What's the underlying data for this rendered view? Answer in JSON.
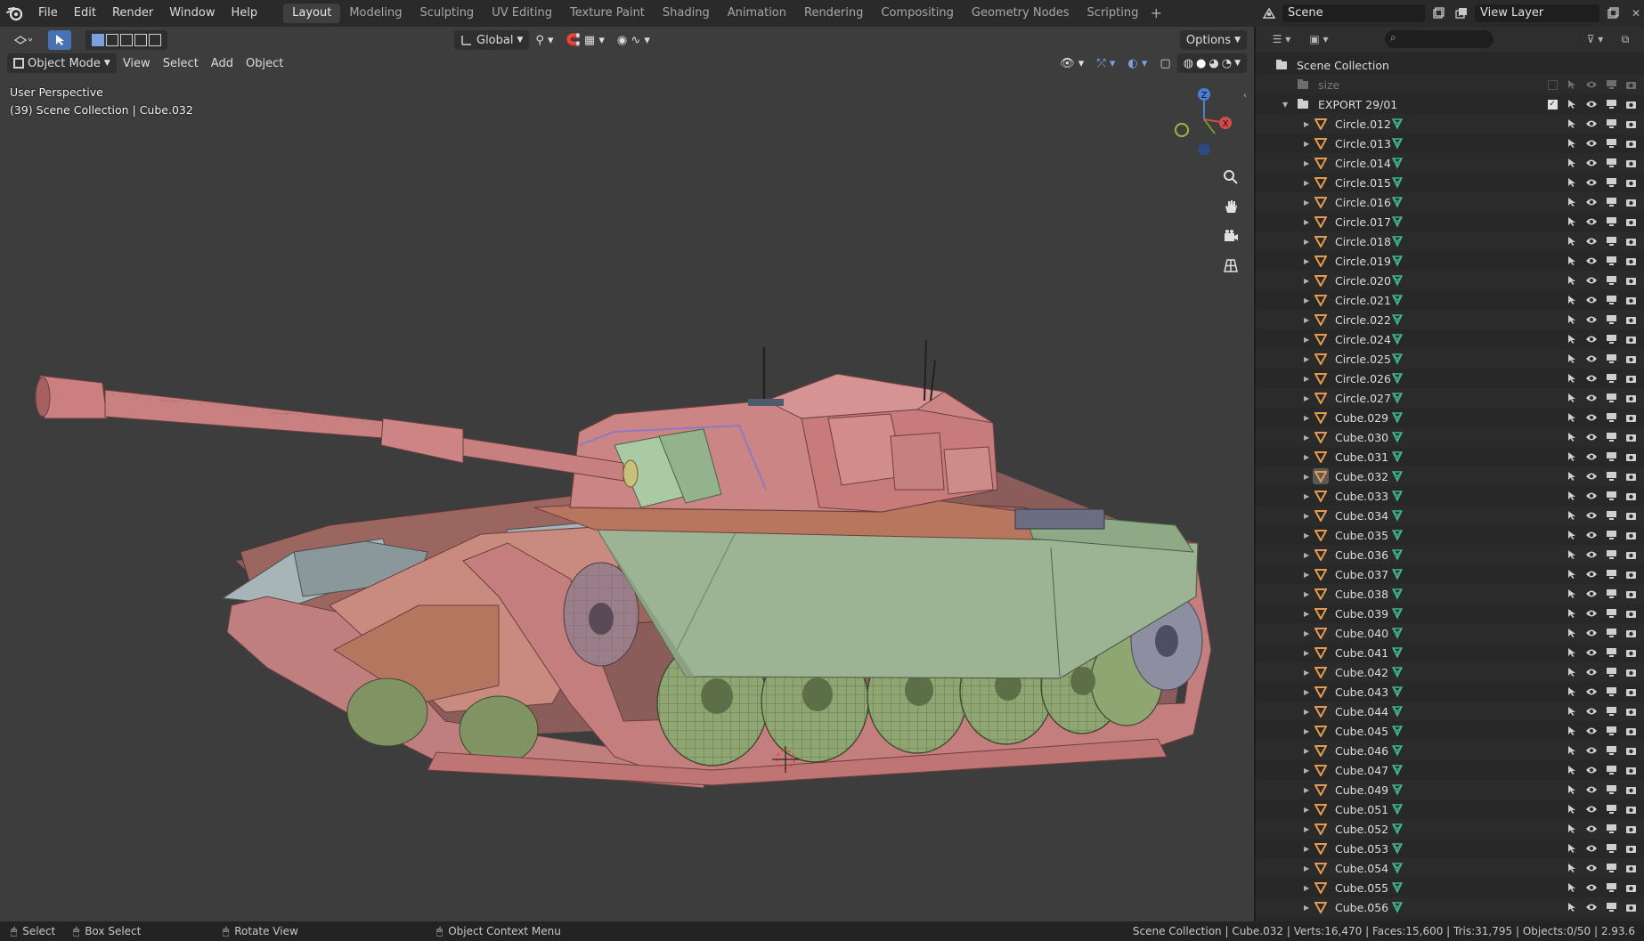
{
  "topbar": {
    "menus": [
      "File",
      "Edit",
      "Render",
      "Window",
      "Help"
    ],
    "workspaces": [
      "Layout",
      "Modeling",
      "Sculpting",
      "UV Editing",
      "Texture Paint",
      "Shading",
      "Animation",
      "Rendering",
      "Compositing",
      "Geometry Nodes",
      "Scripting"
    ],
    "active_workspace": "Layout",
    "scene": "Scene",
    "view_layer": "View Layer"
  },
  "viewport": {
    "transform_orientation": "Global",
    "options_label": "Options",
    "mode": "Object Mode",
    "menus": [
      "View",
      "Select",
      "Add",
      "Object"
    ],
    "perspective_label": "User Perspective",
    "collection_info": "(39) Scene Collection | Cube.032",
    "gizmo": {
      "z": "Z",
      "x": "X"
    }
  },
  "outliner": {
    "root": "Scene Collection",
    "size_item": "size",
    "export_collection": "EXPORT 29/01",
    "objects": [
      "Circle.012",
      "Circle.013",
      "Circle.014",
      "Circle.015",
      "Circle.016",
      "Circle.017",
      "Circle.018",
      "Circle.019",
      "Circle.020",
      "Circle.021",
      "Circle.022",
      "Circle.024",
      "Circle.025",
      "Circle.026",
      "Circle.027",
      "Cube.029",
      "Cube.030",
      "Cube.031",
      "Cube.032",
      "Cube.033",
      "Cube.034",
      "Cube.035",
      "Cube.036",
      "Cube.037",
      "Cube.038",
      "Cube.039",
      "Cube.040",
      "Cube.041",
      "Cube.042",
      "Cube.043",
      "Cube.044",
      "Cube.045",
      "Cube.046",
      "Cube.047",
      "Cube.049",
      "Cube.051",
      "Cube.052",
      "Cube.053",
      "Cube.054",
      "Cube.055",
      "Cube.056"
    ],
    "active_object": "Cube.032"
  },
  "statusbar": {
    "select": "Select",
    "box_select": "Box Select",
    "rotate_view": "Rotate View",
    "context_menu": "Object Context Menu",
    "stats": "Scene Collection | Cube.032 | Verts:16,470 | Faces:15,600 | Tris:31,795 | Objects:0/50 | 2.93.6"
  },
  "colors": {
    "accent_blue": "#4772b3",
    "mesh_orange": "#e69a4c",
    "mesh_data_green": "#3fb58a",
    "tank_pink": "#c77a7a",
    "tank_green": "#9fb596",
    "viewport_bg": "#3d3d3d"
  }
}
